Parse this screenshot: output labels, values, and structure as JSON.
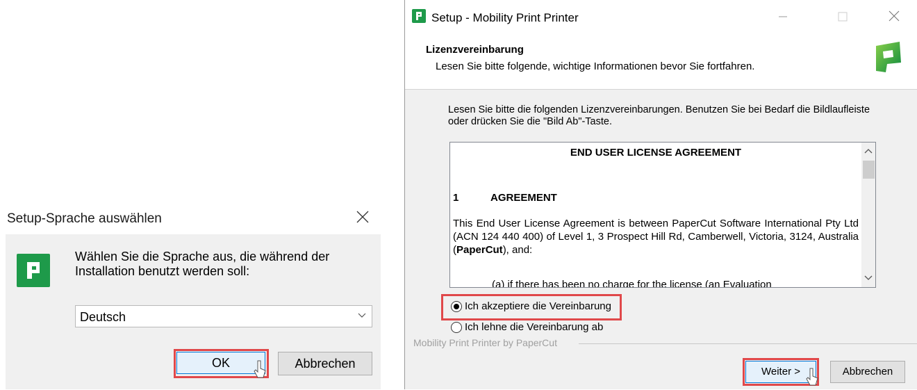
{
  "language_dialog": {
    "title": "Setup-Sprache auswählen",
    "prompt": "Wählen Sie die Sprache aus, die während der Installation benutzt werden soll:",
    "selected_language": "Deutsch",
    "ok_label": "OK",
    "cancel_label": "Abbrechen",
    "icons": {
      "close": "close-icon",
      "logo": "papercut-logo-icon",
      "dropdown": "chevron-down-icon"
    }
  },
  "wizard": {
    "title": "Setup - Mobility Print Printer",
    "heading": "Lizenzvereinbarung",
    "subheading": "Lesen Sie bitte folgende, wichtige Informationen bevor Sie fortfahren.",
    "instructions": "Lesen Sie bitte die folgenden Lizenzvereinbarungen. Benutzen Sie bei Bedarf die Bildlaufleiste oder drücken Sie die \"Bild Ab\"-Taste.",
    "license": {
      "title": "END USER LICENSE AGREEMENT",
      "section_number": "1",
      "section_title": "AGREEMENT",
      "paragraph_part1": "This End User License Agreement is between PaperCut Software International Pty Ltd (ACN 124 440 400) of Level 1, 3 Prospect Hill Rd, Camberwell, Victoria, 3124, Australia (",
      "paragraph_bold": "PaperCut",
      "paragraph_part2": "), and:",
      "cutoff_line": "(a) if there has been no charge for the license (an Evaluation"
    },
    "accept_label": "Ich akzeptiere die Vereinbarung",
    "decline_label": "Ich lehne die Vereinbarung ab",
    "accept_selected": true,
    "footer_brand": "Mobility Print Printer by PaperCut",
    "next_label": "Weiter >",
    "cancel_label": "Abbrechen"
  },
  "colors": {
    "brand_green": "#1e9a4a",
    "highlight_red": "#e0484a",
    "default_button_border": "#0078d7",
    "default_button_fill": "#e5f1fb"
  }
}
